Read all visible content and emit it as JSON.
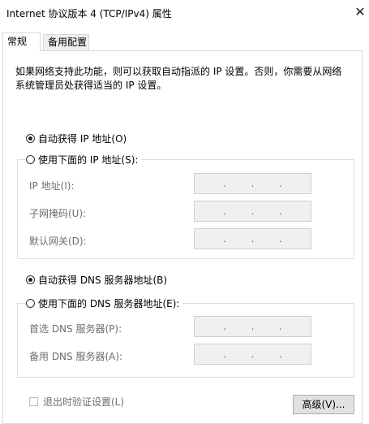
{
  "window": {
    "title": "Internet 协议版本 4 (TCP/IPv4) 属性",
    "close_glyph": "✕"
  },
  "tabs": [
    {
      "label": "常规",
      "active": true
    },
    {
      "label": "备用配置",
      "active": false
    }
  ],
  "description": "如果网络支持此功能，则可以获取自动指派的 IP 设置。否则，你需要从网络系统管理员处获得适当的 IP 设置。",
  "ip": {
    "auto_label": "自动获得 IP 地址(O)",
    "auto_selected": true,
    "manual_label": "使用下面的 IP 地址(S):",
    "manual_selected": false,
    "fields": [
      {
        "label": "IP 地址(I):",
        "value": ""
      },
      {
        "label": "子网掩码(U):",
        "value": ""
      },
      {
        "label": "默认网关(D):",
        "value": ""
      }
    ]
  },
  "dns": {
    "auto_label": "自动获得 DNS 服务器地址(B)",
    "auto_selected": true,
    "manual_label": "使用下面的 DNS 服务器地址(E):",
    "manual_selected": false,
    "fields": [
      {
        "label": "首选 DNS 服务器(P):",
        "value": ""
      },
      {
        "label": "备用 DNS 服务器(A):",
        "value": ""
      }
    ]
  },
  "validate_checkbox": {
    "label": "退出时验证设置(L)",
    "checked": false
  },
  "advanced_button": "高级(V)...",
  "ip_separator": "."
}
